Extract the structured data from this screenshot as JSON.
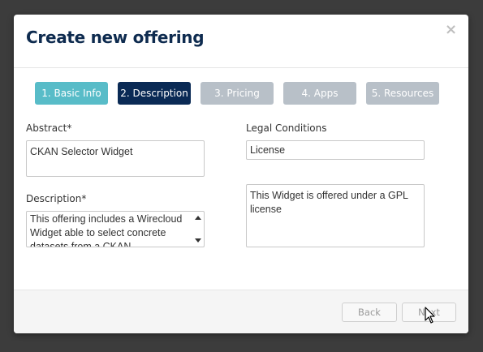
{
  "dialog": {
    "title": "Create new offering",
    "close_label": "×"
  },
  "steps": [
    {
      "label": "1. Basic Info",
      "state": "done"
    },
    {
      "label": "2. Description",
      "state": "active"
    },
    {
      "label": "3. Pricing",
      "state": "todo"
    },
    {
      "label": "4. Apps",
      "state": "todo"
    },
    {
      "label": "5. Resources",
      "state": "todo"
    }
  ],
  "form": {
    "abstract_label": "Abstract*",
    "abstract_value": "CKAN Selector Widget",
    "description_label": "Description*",
    "description_value": "This offering includes a Wirecloud Widget able to select concrete datasets from a CKAN",
    "legal_label": "Legal Conditions",
    "legal_title_value": "License",
    "legal_text_value": "This Widget is offered under a GPL license"
  },
  "footer": {
    "back_label": "Back",
    "next_label": "Next"
  },
  "colors": {
    "title": "#0e2b4f",
    "step_done": "#58bcc8",
    "step_active": "#0a2a55",
    "step_todo": "#b8c0c8"
  }
}
